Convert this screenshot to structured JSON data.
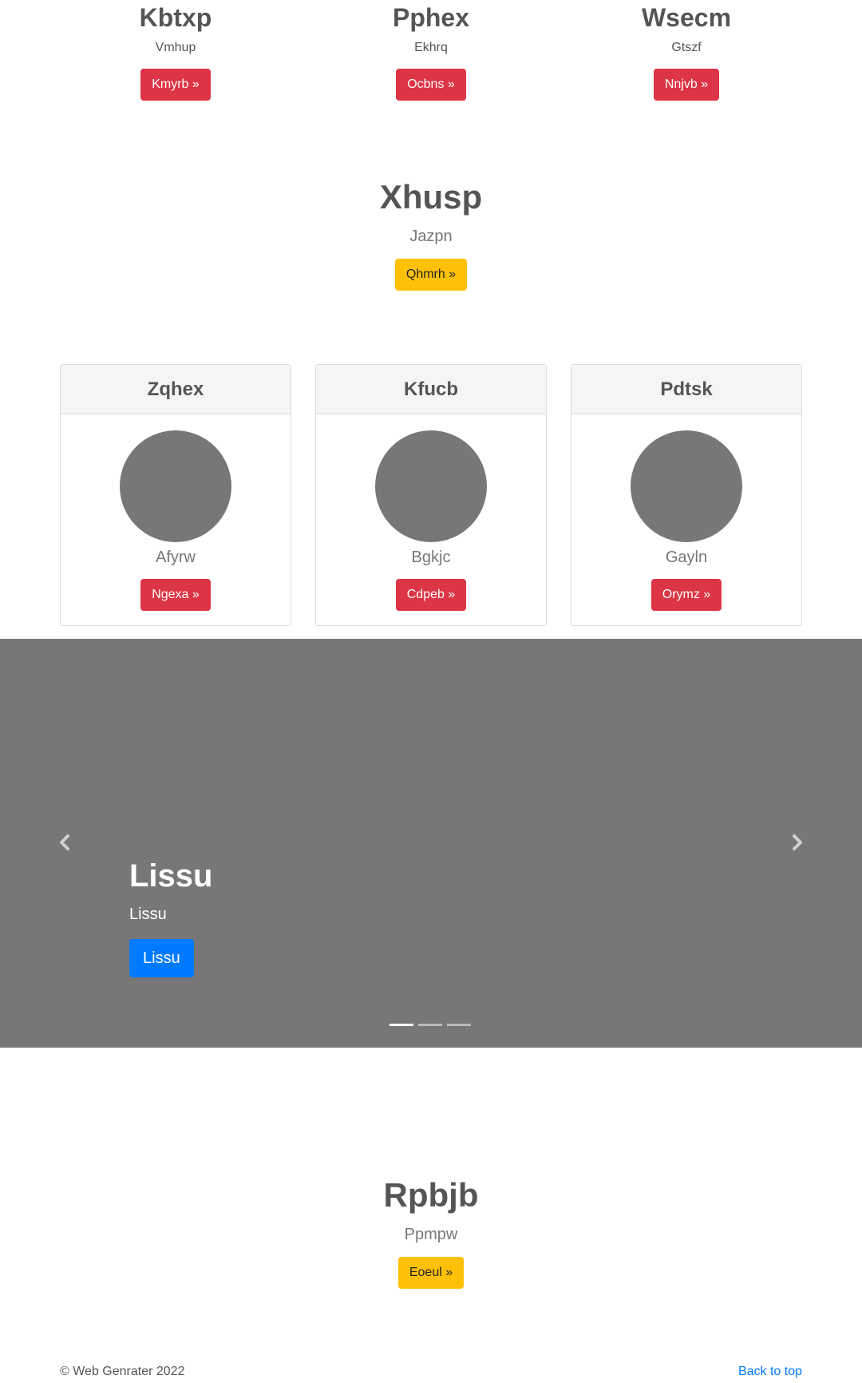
{
  "features": [
    {
      "title": "Kbtxp",
      "subtitle": "Vmhup",
      "button": "Kmyrb »"
    },
    {
      "title": "Pphex",
      "subtitle": "Ekhrq",
      "button": "Ocbns »"
    },
    {
      "title": "Wsecm",
      "subtitle": "Gtszf",
      "button": "Nnjvb »"
    }
  ],
  "hero1": {
    "title": "Xhusp",
    "subtitle": "Jazpn",
    "button": "Qhmrh »"
  },
  "cards": [
    {
      "header": "Zqhex",
      "caption": "Afyrw",
      "button": "Ngexa »"
    },
    {
      "header": "Kfucb",
      "caption": "Bgkjc",
      "button": "Cdpeb »"
    },
    {
      "header": "Pdtsk",
      "caption": "Gayln",
      "button": "Orymz »"
    }
  ],
  "carousel": {
    "title": "Lissu",
    "text": "Lissu",
    "button": "Lissu",
    "prev_icon": "chevron-left-icon",
    "next_icon": "chevron-right-icon",
    "slides": 3,
    "active_slide": 1,
    "background": "#777777"
  },
  "hero2": {
    "title": "Rpbjb",
    "subtitle": "Ppmpw",
    "button": "Eoeul »"
  },
  "footer": {
    "copyright": "© Web Genrater 2022",
    "back_to_top": "Back to top"
  },
  "colors": {
    "danger": "#dc3545",
    "warning": "#ffc107",
    "primary": "#007bff",
    "placeholder": "#777777"
  }
}
